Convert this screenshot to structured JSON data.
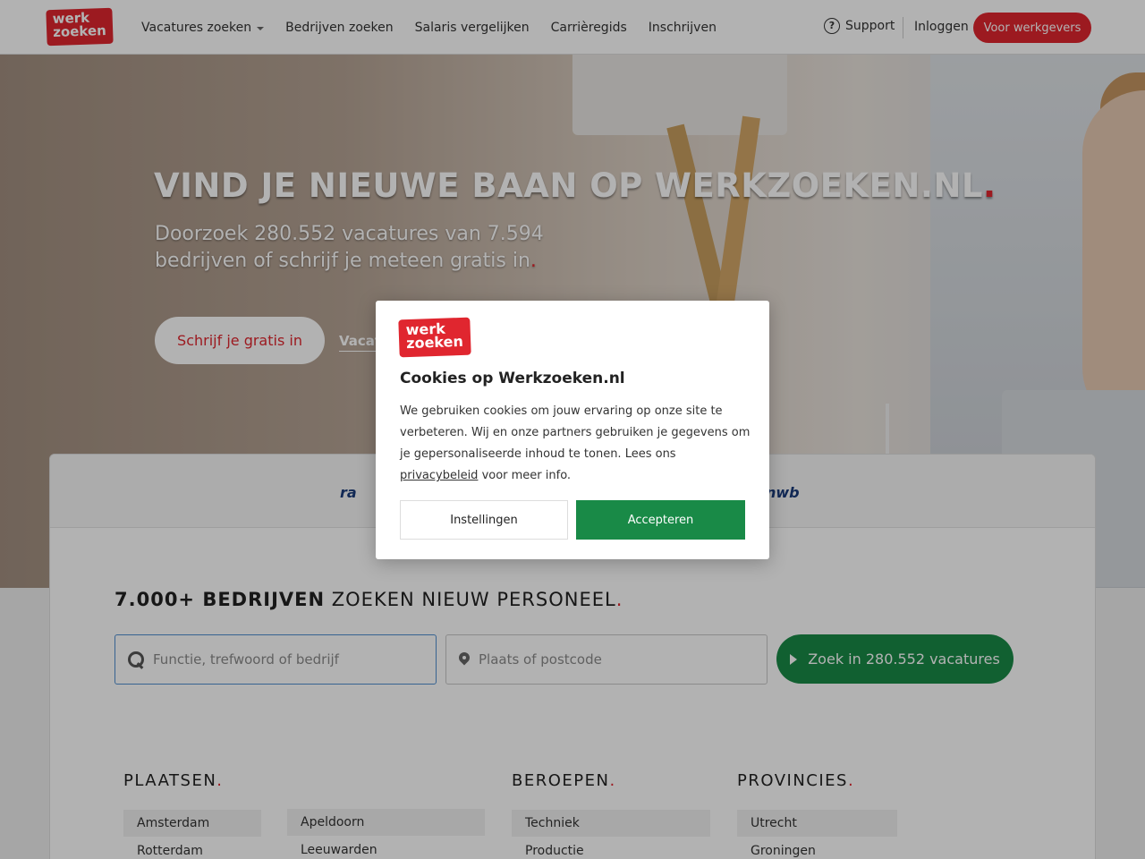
{
  "header": {
    "logo_line1": "werk",
    "logo_line2": "zoeken",
    "nav": [
      "Vacatures zoeken",
      "Bedrijven zoeken",
      "Salaris vergelijken",
      "Carrièregids",
      "Inschrijven"
    ],
    "support": "Support",
    "login": "Inloggen",
    "employers": "Voor werkgevers"
  },
  "hero": {
    "title": "VIND JE NIEUWE BAAN OP WERKZOEKEN.NL",
    "title_dot": ".",
    "subtitle": "Doorzoek 280.552 vacatures van 7.594 bedrijven of schrijf je meteen gratis in",
    "subtitle_dot": ".",
    "signup_button": "Schrijf je gratis in",
    "link": "Vacat"
  },
  "partners": {
    "left": "ra",
    "right": "nwb"
  },
  "search_card": {
    "title_bold": "7.000+ BEDRIJVEN",
    "title_rest": " ZOEKEN NIEUW PERSONEEL",
    "title_dot": ".",
    "keyword_placeholder": "Functie, trefwoord of bedrijf",
    "location_placeholder": "Plaats of postcode",
    "search_button": "Zoek in 280.552 vacatures"
  },
  "sections": {
    "places_title": "PLAATSEN",
    "places_col1": [
      "Amsterdam",
      "Rotterdam"
    ],
    "places_col2": [
      "Apeldoorn",
      "Leeuwarden"
    ],
    "jobs_title": "BEROEPEN",
    "jobs": [
      "Techniek",
      "Productie"
    ],
    "provinces_title": "PROVINCIES",
    "provinces": [
      "Utrecht",
      "Groningen"
    ],
    "dot": "."
  },
  "cookie_modal": {
    "logo_line1": "werk",
    "logo_line2": "zoeken",
    "title": "Cookies op Werkzoeken.nl",
    "text_before": "We gebruiken cookies om jouw ervaring op onze site te verbeteren. Wij en onze partners gebruiken je gegevens om je gepersonaliseerde inhoud te tonen. Lees ons ",
    "link": "privacybeleid",
    "text_after": " voor meer info.",
    "settings_button": "Instellingen",
    "accept_button": "Accepteren"
  },
  "colors": {
    "brand_red": "#e0262f",
    "accept_green": "#198a47"
  }
}
